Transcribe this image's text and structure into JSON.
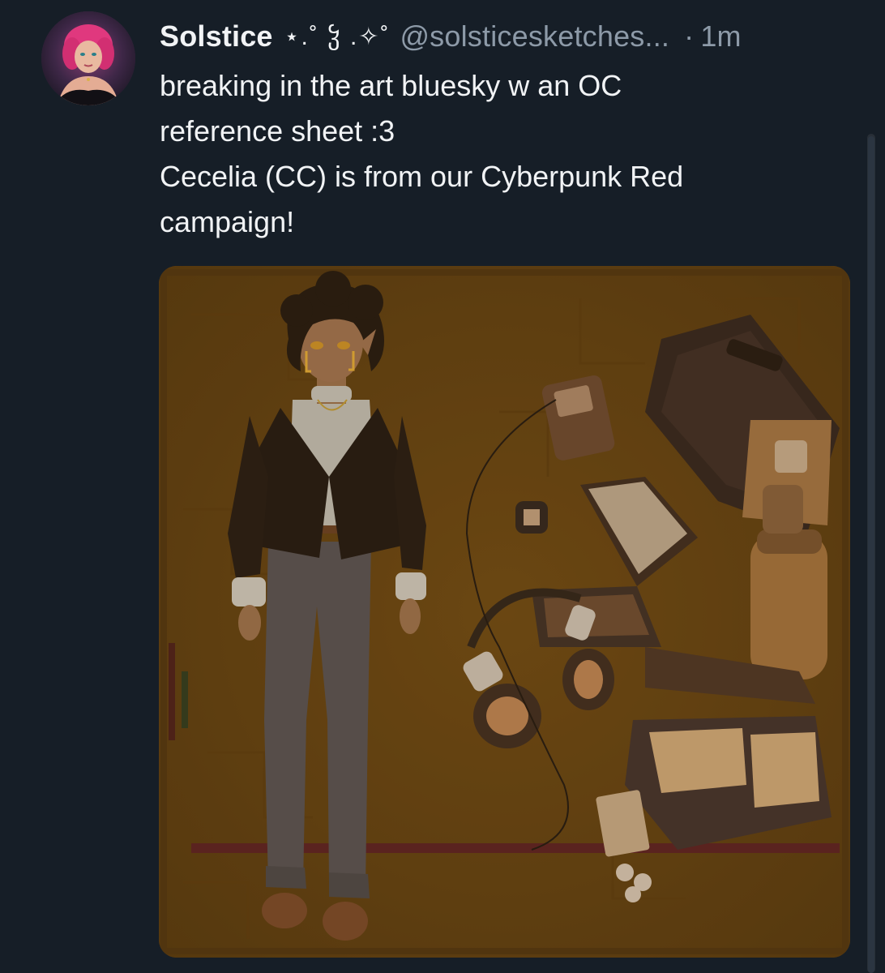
{
  "post": {
    "display_name": "Solstice",
    "name_decoration": "⋆.˚ ჴ .✧˚",
    "handle": "@solsticesketches...",
    "separator": "·",
    "timestamp": "1m",
    "text_lines": [
      "breaking in the art bluesky w an OC",
      "reference sheet :3",
      "Cecelia (CC) is from our Cyberpunk Red",
      "campaign!"
    ]
  },
  "colors": {
    "background": "#161e27",
    "text_primary": "#f1f3f5",
    "text_secondary": "#8d9aa8",
    "image_bg": "#6e4a16"
  }
}
